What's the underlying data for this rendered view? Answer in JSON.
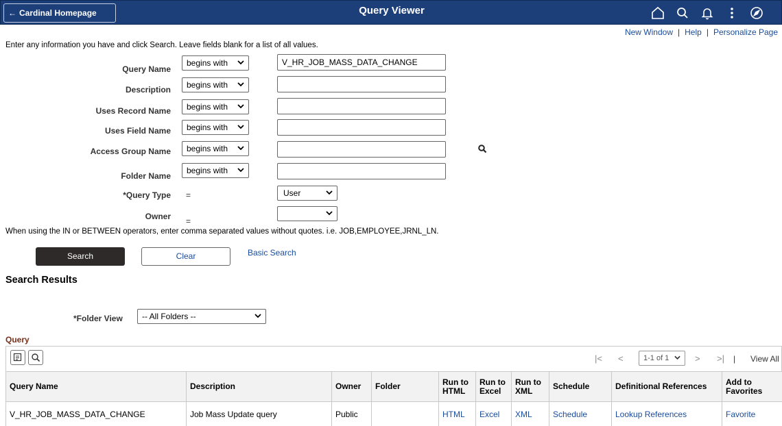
{
  "header": {
    "back_label": "Cardinal Homepage",
    "title": "Query Viewer"
  },
  "toplinks": {
    "new_window": "New Window",
    "help": "Help",
    "personalize": "Personalize Page",
    "sep": "|"
  },
  "instructions": "Enter any information you have and click Search. Leave fields blank for a list of all values.",
  "criteria": {
    "query_name": {
      "label": "Query Name",
      "operator": "begins with",
      "value": "V_HR_JOB_MASS_DATA_CHANGE"
    },
    "description": {
      "label": "Description",
      "operator": "begins with",
      "value": ""
    },
    "uses_record_name": {
      "label": "Uses Record Name",
      "operator": "begins with",
      "value": ""
    },
    "uses_field_name": {
      "label": "Uses Field Name",
      "operator": "begins with",
      "value": ""
    },
    "access_group_name": {
      "label": "Access Group Name",
      "operator": "begins with",
      "value": ""
    },
    "folder_name": {
      "label": "Folder Name",
      "operator": "begins with",
      "value": ""
    },
    "query_type": {
      "label": "*Query Type",
      "operator": "=",
      "value": "User"
    },
    "owner": {
      "label": "Owner",
      "operator": "=",
      "value": ""
    }
  },
  "operator_note": "When using the IN or BETWEEN operators, enter comma separated values without quotes. i.e. JOB,EMPLOYEE,JRNL_LN.",
  "buttons": {
    "search": "Search",
    "clear": "Clear",
    "basic_search": "Basic Search"
  },
  "search_results": {
    "title": "Search Results",
    "folder_view_label": "*Folder View",
    "folder_view_value": "-- All Folders --"
  },
  "grid": {
    "title": "Query",
    "pagination": "1-1 of 1",
    "view_all": "View All",
    "pipe": "|",
    "columns": [
      "Query Name",
      "Description",
      "Owner",
      "Folder",
      "Run to HTML",
      "Run to Excel",
      "Run to XML",
      "Schedule",
      "Definitional References",
      "Add to Favorites"
    ],
    "rows": [
      [
        "V_HR_JOB_MASS_DATA_CHANGE",
        "Job Mass Update query",
        "Public",
        "",
        "HTML",
        "Excel",
        "XML",
        "Schedule",
        "Lookup References",
        "Favorite"
      ]
    ]
  },
  "colors": {
    "header_bg": "#1c3f7a",
    "link": "#1a4b9c",
    "grid_title": "#7a2f1a",
    "search_btn": "#2e2a2a"
  },
  "icons": [
    "home-icon",
    "search-icon",
    "bell-icon",
    "more-icon",
    "compass-icon",
    "lookup-icon",
    "personalize-grid-icon",
    "grid-search-icon",
    "first-page-icon",
    "prev-page-icon",
    "next-page-icon",
    "last-page-icon",
    "chevron-down-icon"
  ]
}
